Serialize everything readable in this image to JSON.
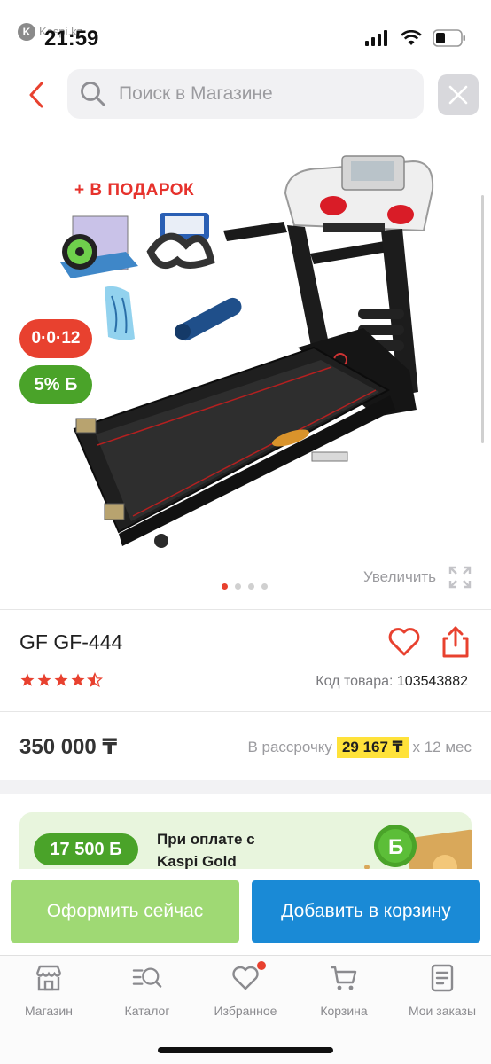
{
  "status_bar": {
    "time": "21:59",
    "app_badge": "Kaspi.kz",
    "icons": [
      "signal-icon",
      "wifi-icon",
      "battery-icon"
    ]
  },
  "search": {
    "placeholder": "Поиск в Магазине",
    "back_icon": "chevron-left-icon",
    "clear_icon": "close-icon"
  },
  "gallery": {
    "promo_text": "+ В ПОДАРОК",
    "installment_badge": "0·0·12",
    "bonus_badge": "5% Б",
    "zoom_label": "Увеличить",
    "dots_total": 4,
    "dots_active": 1
  },
  "product": {
    "title": "GF GF-444",
    "rating_stars": 4.5,
    "sku_label": "Код товара:",
    "sku_value": "103543882",
    "price": "350 000 ₸",
    "installment_prefix": "В рассрочку",
    "installment_amount": "29 167 ₸",
    "installment_suffix": "х 12 мес"
  },
  "gold_banner": {
    "bonus_amount": "17 500 Б",
    "text": "При оплате с Kaspi Gold"
  },
  "actions": {
    "buy_now": "Оформить сейчас",
    "add_to_cart": "Добавить в корзину"
  },
  "tabs": [
    {
      "label": "Магазин",
      "icon": "store-icon"
    },
    {
      "label": "Каталог",
      "icon": "catalog-search-icon"
    },
    {
      "label": "Избранное",
      "icon": "heart-icon"
    },
    {
      "label": "Корзина",
      "icon": "cart-icon"
    },
    {
      "label": "Мои заказы",
      "icon": "orders-icon"
    }
  ],
  "colors": {
    "accent_red": "#e8412f",
    "bonus_green": "#4aa329",
    "buy_now_green": "#9fd974",
    "cart_blue": "#1a8ad6",
    "installment_yellow": "#ffe23a"
  }
}
